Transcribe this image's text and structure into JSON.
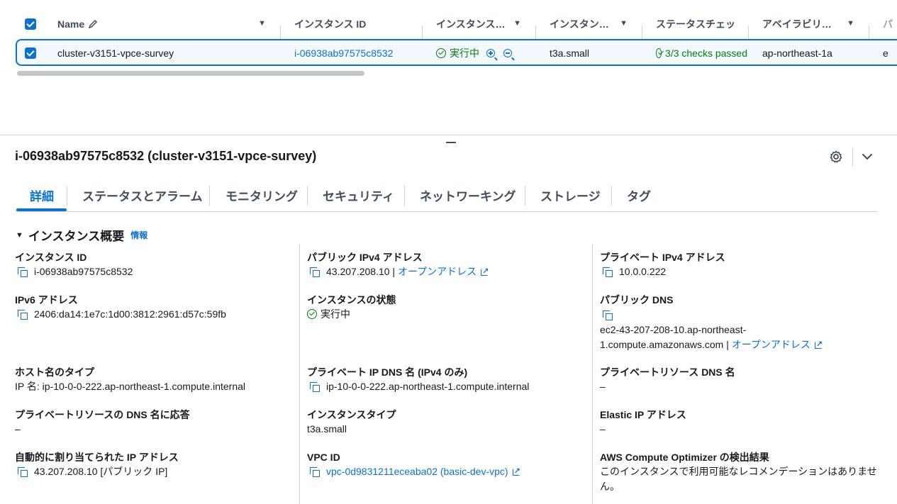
{
  "table": {
    "columns": [
      {
        "label": "Name"
      },
      {
        "label": "インスタンス ID"
      },
      {
        "label": "インスタンス…"
      },
      {
        "label": "インスタン…"
      },
      {
        "label": "ステータスチェッ"
      },
      {
        "label": "アベイラビリテ…"
      },
      {
        "label": "パ"
      }
    ],
    "row": {
      "name": "cluster-v3151-vpce-survey",
      "instance_id": "i-06938ab97575c8532",
      "state": "実行中",
      "type": "t3a.small",
      "checks": "3/3 checks passed",
      "az": "ap-northeast-1a",
      "extra": "e"
    }
  },
  "detail": {
    "title": "i-06938ab97575c8532 (cluster-v3151-vpce-survey)",
    "tabs": [
      "詳細",
      "ステータスとアラーム",
      "モニタリング",
      "セキュリティ",
      "ネットワーキング",
      "ストレージ",
      "タグ"
    ],
    "section_title": "インスタンス概要",
    "section_info": "情報",
    "col1": {
      "instance_id_label": "インスタンス ID",
      "instance_id_value": "i-06938ab97575c8532",
      "ipv6_label": "IPv6 アドレス",
      "ipv6_value": "2406:da14:1e7c:1d00:3812:2961:d57c:59fb",
      "hostname_type_label": "ホスト名のタイプ",
      "hostname_type_value": "IP 名: ip-10-0-0-222.ap-northeast-1.compute.internal",
      "answer_dns_label": "プライベートリソースの DNS 名に応答",
      "answer_dns_value": "–",
      "auto_ip_label": "自動的に割り当てられた IP アドレス",
      "auto_ip_value": "43.207.208.10 [パブリック IP]"
    },
    "col2": {
      "public_ipv4_label": "パブリック IPv4 アドレス",
      "public_ipv4_value": "43.207.208.10 |",
      "open_address": "オープンアドレス",
      "state_label": "インスタンスの状態",
      "state_value": "実行中",
      "private_dns_label": "プライベート IP DNS 名 (IPv4 のみ)",
      "private_dns_value": "ip-10-0-0-222.ap-northeast-1.compute.internal",
      "instance_type_label": "インスタンスタイプ",
      "instance_type_value": "t3a.small",
      "vpc_label": "VPC ID",
      "vpc_value": "vpc-0d9831211eceaba02 (basic-dev-vpc)"
    },
    "col3": {
      "private_ipv4_label": "プライベート IPv4 アドレス",
      "private_ipv4_value": "10.0.0.222",
      "public_dns_label": "パブリック DNS",
      "public_dns_line1": "ec2-43-207-208-10.ap-northeast-",
      "public_dns_line2": "1.compute.amazonaws.com |",
      "open_address": "オープンアドレス",
      "private_resource_dns_label": "プライベートリソース DNS 名",
      "private_resource_dns_value": "–",
      "elastic_ip_label": "Elastic IP アドレス",
      "elastic_ip_value": "–",
      "optimizer_label": "AWS Compute Optimizer の検出結果",
      "optimizer_line1": "このインスタンスで利用可能なレコメンデーションはありませ",
      "optimizer_line2": "ん。"
    }
  },
  "colors": {
    "accent": "#0972d3",
    "success": "#037f0c",
    "text": "#16191f",
    "border": "#d1d5db"
  }
}
